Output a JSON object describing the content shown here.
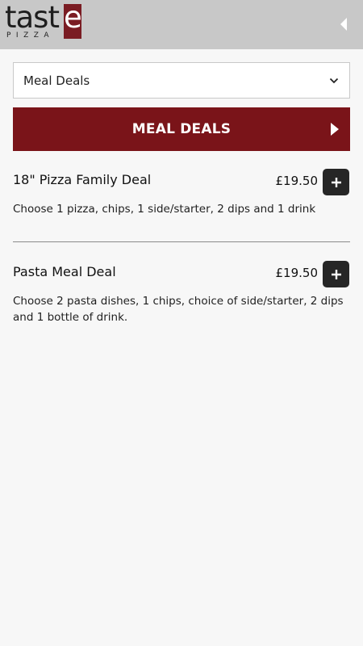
{
  "header": {
    "logo_word": "tast",
    "logo_letter": "e",
    "logo_sub": "PIZZA",
    "back_icon": "chevron-left-icon"
  },
  "category_select": {
    "value": "Meal Deals",
    "icon": "chevron-down-icon"
  },
  "section": {
    "title": "MEAL DEALS",
    "icon": "play-arrow-icon"
  },
  "items": [
    {
      "name": "18\" Pizza Family Deal",
      "price": "£19.50",
      "description": "Choose 1 pizza, chips, 1 side/starter, 2 dips and 1 drink"
    },
    {
      "name": "Pasta Meal Deal",
      "price": "£19.50",
      "description": "Choose 2 pasta dishes, 1 chips, choice of side/starter, 2 dips and 1 bottle of drink."
    }
  ],
  "colors": {
    "brand": "#7a1419",
    "header_bg": "#c8c8c8",
    "add_button": "#262626"
  }
}
